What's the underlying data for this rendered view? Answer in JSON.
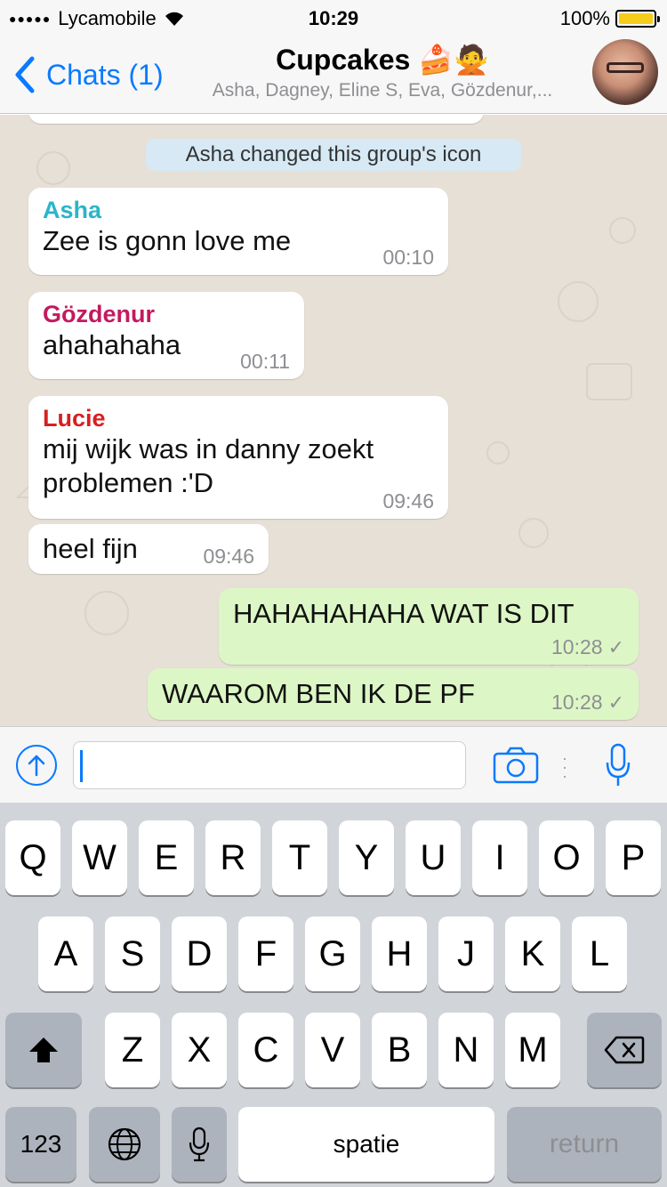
{
  "status_bar": {
    "signal": "●●●●●",
    "carrier": "Lycamobile",
    "wifi_icon": "wifi-icon",
    "time": "10:29",
    "battery_percent": "100%",
    "battery_level": 1.0,
    "battery_color": "#f5cd1a"
  },
  "nav": {
    "back_label": "Chats (1)",
    "title": "Cupcakes 🍰🙅",
    "subtitle": "Asha, Dagney, Eline S, Eva, Gözdenur,..."
  },
  "chat": {
    "system_message": "Asha changed this group's icon",
    "messages": [
      {
        "sender": "Asha",
        "sender_color": "#2ab5c9",
        "text": "Zee is gonn love me",
        "time": "00:10"
      },
      {
        "sender": "Gözdenur",
        "sender_color": "#c4195f",
        "text": "ahahahaha",
        "time": "00:11"
      },
      {
        "sender": "Lucie",
        "sender_color": "#d81f1f",
        "text": "mij wijk was in danny zoekt problemen :'D",
        "time": "09:46"
      },
      {
        "sender": "",
        "text": "heel fijn",
        "time": "09:46"
      },
      {
        "sender": "",
        "text": "HAHAHAHAHA WAT IS DIT",
        "time": "10:28",
        "outgoing": true
      },
      {
        "sender": "",
        "text": "WAAROM BEN IK DE PF",
        "time": "10:28",
        "outgoing": true
      }
    ]
  },
  "input": {
    "value": "",
    "placeholder": ""
  },
  "keyboard": {
    "row1": [
      "Q",
      "W",
      "E",
      "R",
      "T",
      "Y",
      "U",
      "I",
      "O",
      "P"
    ],
    "row2": [
      "A",
      "S",
      "D",
      "F",
      "G",
      "H",
      "J",
      "K",
      "L"
    ],
    "row3": [
      "Z",
      "X",
      "C",
      "V",
      "B",
      "N",
      "M"
    ],
    "numbers_label": "123",
    "space_label": "spatie",
    "return_label": "return"
  },
  "colors": {
    "accent": "#0a7aff",
    "outgoing_bubble": "#dcf7c5",
    "chat_background": "#e6e0d6"
  }
}
